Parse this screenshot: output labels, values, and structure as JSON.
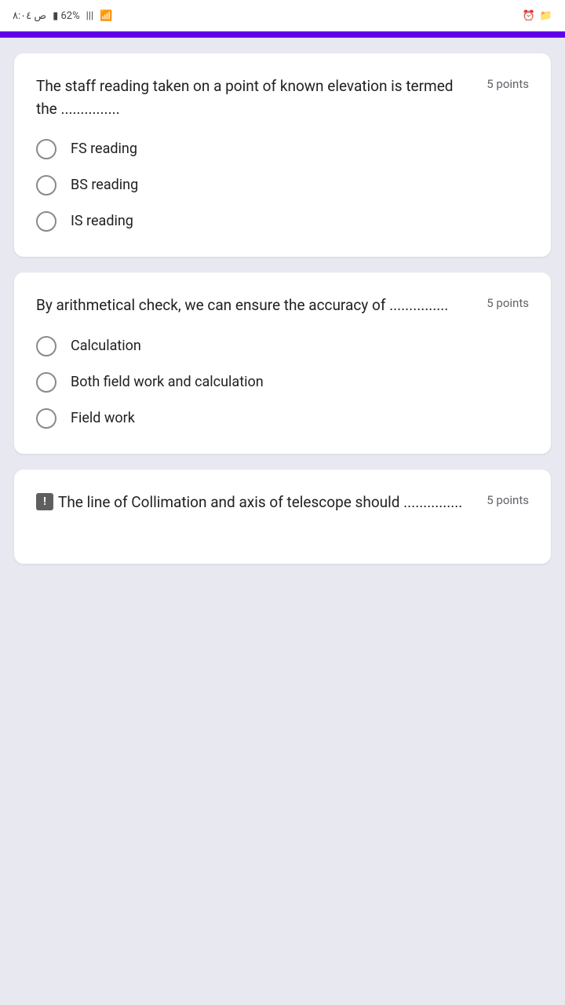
{
  "statusBar": {
    "leftText": "ص ۸:۰٤",
    "battery": "62%",
    "signal": "|||",
    "rightIcons": [
      "alarm-icon",
      "folder-icon"
    ]
  },
  "purpleBar": {
    "color": "#6200ea"
  },
  "questions": [
    {
      "id": "q1",
      "text": "The staff reading taken on a point of known elevation is termed the ...............",
      "points": "5 points",
      "options": [
        {
          "id": "q1o1",
          "label": "FS reading"
        },
        {
          "id": "q1o2",
          "label": "BS reading"
        },
        {
          "id": "q1o3",
          "label": "IS reading"
        }
      ]
    },
    {
      "id": "q2",
      "text": "By arithmetical check, we can ensure the accuracy of ...............",
      "points": "5 points",
      "options": [
        {
          "id": "q2o1",
          "label": "Calculation"
        },
        {
          "id": "q2o2",
          "label": "Both field work and calculation"
        },
        {
          "id": "q2o3",
          "label": "Field work"
        }
      ]
    },
    {
      "id": "q3",
      "text": "The line of Collimation and axis of telescope should ...............",
      "points": "5 points",
      "options": []
    }
  ]
}
